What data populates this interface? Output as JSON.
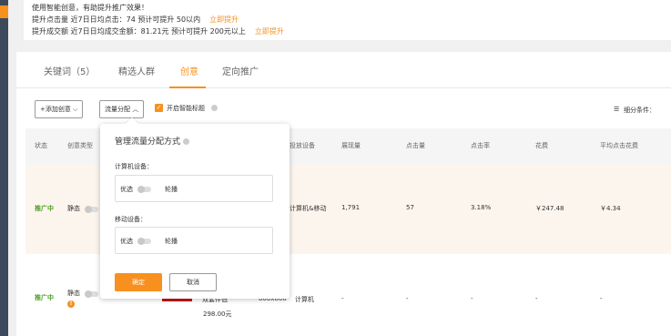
{
  "top": {
    "line1": "使用智能创意，有助提升推广效果！",
    "line2": "提升点击量 近7日日均点击：74   预计可提升 50以内",
    "line2_link": "立即提升",
    "line3": "提升成交额 近7日日均成交金额：81.21元   预计可提升 200元以上",
    "line3_link": "立即提升"
  },
  "tabs": [
    "关键词（5）",
    "精选人群",
    "创意",
    "定向推广"
  ],
  "active_tab": "创意",
  "toolbar": {
    "add_creative": "+添加创意",
    "flow_split": "流量分配",
    "smart_title": "开启智能标题",
    "breakdown": "细分条件："
  },
  "table": {
    "headers": {
      "status": "状态",
      "creative_type": "创意类型",
      "device": "投放设备",
      "impressions": "展现量",
      "clicks": "点击量",
      "ctr": "点击率",
      "cost": "花费",
      "avg_cpc": "平均点击花费"
    },
    "row1": {
      "status": "推广中",
      "type": "静态",
      "device": "计算机&移动",
      "impressions": "1,791",
      "clicks": "57",
      "ctr": "3.18%",
      "cost": "￥247.48",
      "avg_cpc": "￥4.34"
    },
    "row2": {
      "status": "推广中",
      "type": "静态",
      "title_snippet": "双套件低",
      "size": "800x800",
      "device": "计算机",
      "price": "298.00元",
      "impressions": "-",
      "clicks": "-",
      "ctr": "-",
      "cost": "-",
      "avg_cpc": "-"
    }
  },
  "popup": {
    "title": "管理流量分配方式",
    "pc_label": "计算机设备：",
    "mobile_label": "移动设备：",
    "opt_preferred": "优选",
    "opt_rotate": "轮播",
    "confirm": "确定",
    "cancel": "取消"
  },
  "colors": {
    "accent": "#f7901e",
    "status_green": "#4b9e23"
  }
}
